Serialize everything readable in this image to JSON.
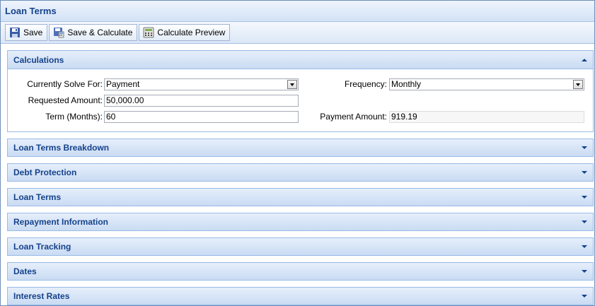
{
  "window": {
    "title": "Loan Terms"
  },
  "toolbar": {
    "save": "Save",
    "save_calculate": "Save & Calculate",
    "calculate_preview": "Calculate Preview"
  },
  "calculations": {
    "title": "Calculations",
    "solve_for_label": "Currently Solve For:",
    "solve_for_value": "Payment",
    "requested_label": "Requested Amount:",
    "requested_value": "50,000.00",
    "term_label": "Term (Months):",
    "term_value": "60",
    "frequency_label": "Frequency:",
    "frequency_value": "Monthly",
    "payment_label": "Payment Amount:",
    "payment_value": "919.19"
  },
  "sections": [
    "Loan Terms Breakdown",
    "Debt Protection",
    "Loan Terms",
    "Repayment Information",
    "Loan Tracking",
    "Dates",
    "Interest Rates"
  ],
  "colors": {
    "header_text": "#15428b",
    "border": "#99bbe8"
  }
}
